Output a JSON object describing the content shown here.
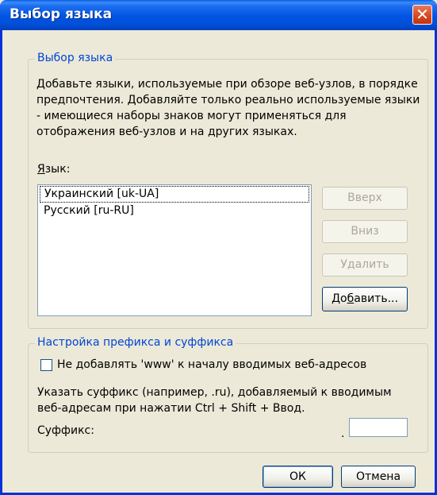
{
  "window": {
    "title": "Выбор языка",
    "close_symbol": "✕"
  },
  "language_group": {
    "legend": "Выбор языка",
    "description": "Добавьте языки, используемые при обзоре веб-узлов, в порядке предпочтения. Добавляйте только реально используемые языки - имеющиеся наборы знаков могут применяться для отображения веб-узлов и на других языках.",
    "list_label_accel": "Я",
    "list_label_rest": "зык:",
    "languages": [
      {
        "label": "Украинский [uk-UA]",
        "selected": true
      },
      {
        "label": "Русский [ru-RU]",
        "selected": false
      }
    ],
    "buttons": {
      "up": {
        "label": "Вверх",
        "enabled": false
      },
      "down": {
        "label": "Вниз",
        "enabled": false
      },
      "remove": {
        "label": "Удалить",
        "enabled": false
      },
      "add_accel": "До",
      "add_accel_char": "б",
      "add_rest": "авить..."
    }
  },
  "prefix_group": {
    "legend": "Настройка префикса и суффикса",
    "www_checkbox_label": "Не добавлять 'www' к началу вводимых веб-адресов",
    "www_checked": false,
    "suffix_description": "Указать суффикс (например, .ru), добавляемый к вводимым веб-адресам при нажатии Ctrl + Shift + Ввод.",
    "suffix_label": "Суффикс:",
    "suffix_dot": ".",
    "suffix_value": ""
  },
  "footer": {
    "ok_label": "ОК",
    "cancel_label": "Отмена"
  },
  "colors": {
    "titlebar": "#0054e3",
    "legend_text": "#0046d5",
    "close_button": "#d6471e",
    "dialog_bg": "#ece9d8"
  }
}
